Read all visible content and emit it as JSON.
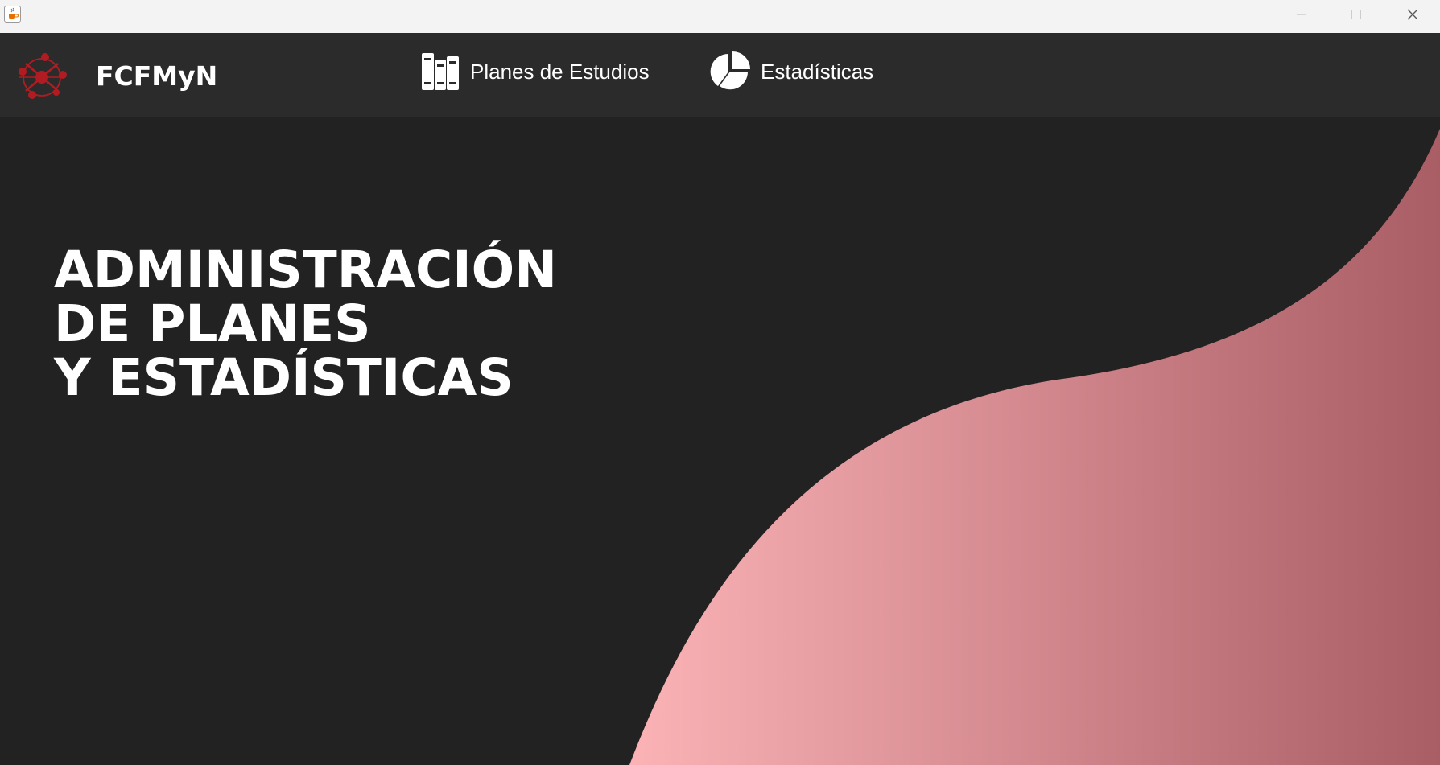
{
  "window": {
    "app_icon": "java-cup-icon",
    "controls": {
      "minimize": "minimize-icon",
      "maximize": "maximize-icon",
      "close": "close-icon"
    }
  },
  "header": {
    "logo_icon": "faculty-logo-icon",
    "brand": "FCFMyN",
    "nav": [
      {
        "label": "Planes de Estudios",
        "icon": "books-icon"
      },
      {
        "label": "Estadísticas",
        "icon": "pie-chart-icon"
      }
    ]
  },
  "hero": {
    "title_lines": [
      "ADMINISTRACIÓN",
      "DE PLANES",
      "Y ESTADÍSTICAS"
    ]
  },
  "colors": {
    "background": "#222222",
    "navbar": "#2b2b2b",
    "titlebar": "#f3f3f3",
    "wave_light": "#fbb3b6",
    "wave_dark": "#a95d65",
    "logo_red": "#b01c22"
  }
}
